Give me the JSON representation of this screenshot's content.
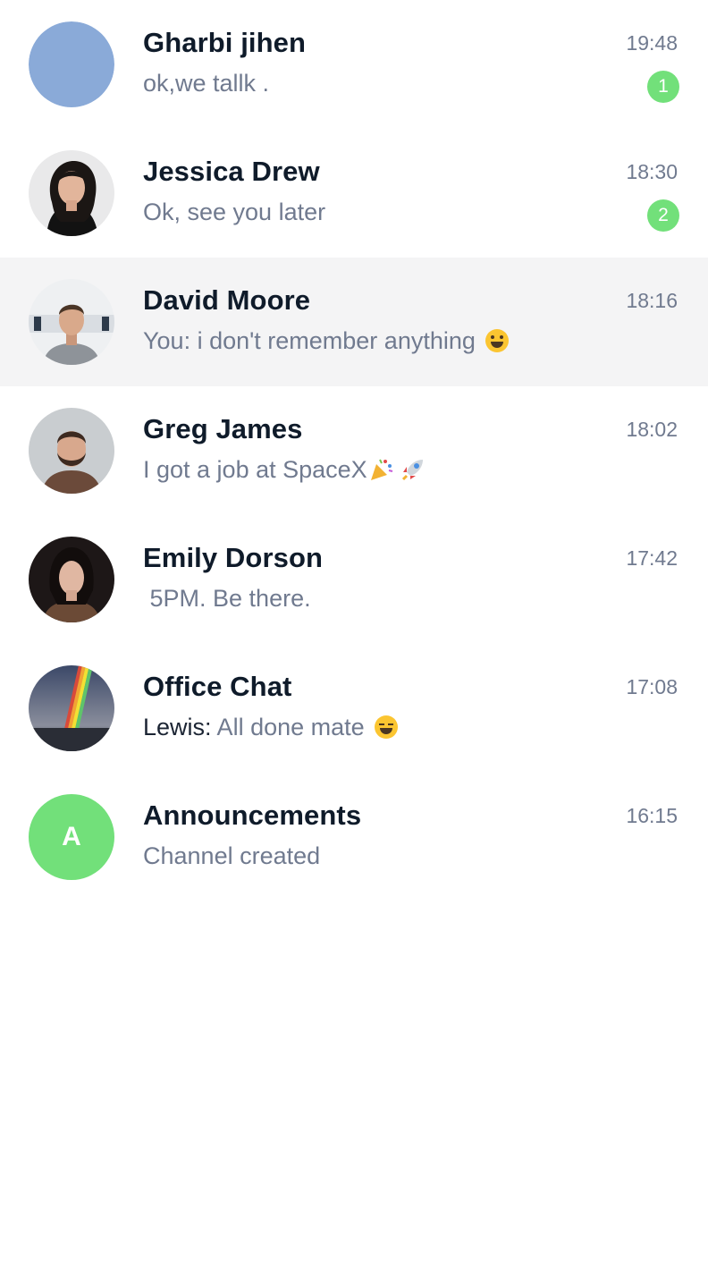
{
  "chats": [
    {
      "name": "Gharbi jihen",
      "time": "19:48",
      "preview": "ok,we tallk .",
      "unread": "1",
      "avatar_icon": "placeholder-avatar",
      "avatar_color": "#8aaad8"
    },
    {
      "name": "Jessica Drew",
      "time": "18:30",
      "preview": "Ok, see you later",
      "unread": "2",
      "avatar_icon": "person-photo-avatar"
    },
    {
      "name": "David Moore",
      "time": "18:16",
      "preview": "You: i don't remember anything",
      "preview_emoji": "grinning-face",
      "selected": true,
      "avatar_icon": "person-photo-avatar"
    },
    {
      "name": "Greg James",
      "time": "18:02",
      "preview": "I got a job at SpaceX",
      "preview_emoji": "party-popper rocket",
      "avatar_icon": "person-photo-avatar"
    },
    {
      "name": "Emily Dorson",
      "time": "17:42",
      "preview": " 5PM. Be there.",
      "avatar_icon": "person-photo-avatar"
    },
    {
      "name": "Office Chat",
      "time": "17:08",
      "preview_sender": "Lewis",
      "preview": " All done mate",
      "preview_emoji": "squinting-face",
      "avatar_icon": "rainbow-photo-avatar"
    },
    {
      "name": "Announcements",
      "time": "16:15",
      "preview": "Channel created",
      "avatar_letter": "A",
      "avatar_color": "#72e07a"
    }
  ],
  "colors": {
    "name_text": "#0f1b2a",
    "secondary_text": "#707a8f",
    "badge": "#72e07a",
    "selected_row": "#f4f4f5"
  }
}
